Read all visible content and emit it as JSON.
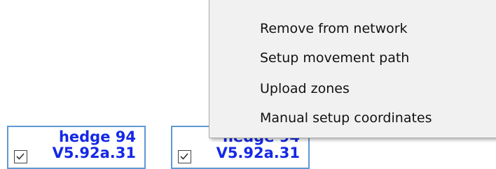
{
  "devices": [
    {
      "name": "hedge 94",
      "version": "V5.92a.31",
      "checked": true
    },
    {
      "name": "hedge 94",
      "version": "V5.92a.31",
      "checked": true
    }
  ],
  "context_menu": {
    "items": [
      {
        "label": "Remove from network"
      },
      {
        "label": "Setup movement path"
      },
      {
        "label": "Upload zones"
      },
      {
        "label": "Manual setup coordinates"
      }
    ]
  },
  "colors": {
    "device_text": "#1428e6",
    "card_border": "#5f98d4",
    "menu_background": "#f1f1f1"
  },
  "icons": {
    "checkbox": "checkmark-icon"
  }
}
